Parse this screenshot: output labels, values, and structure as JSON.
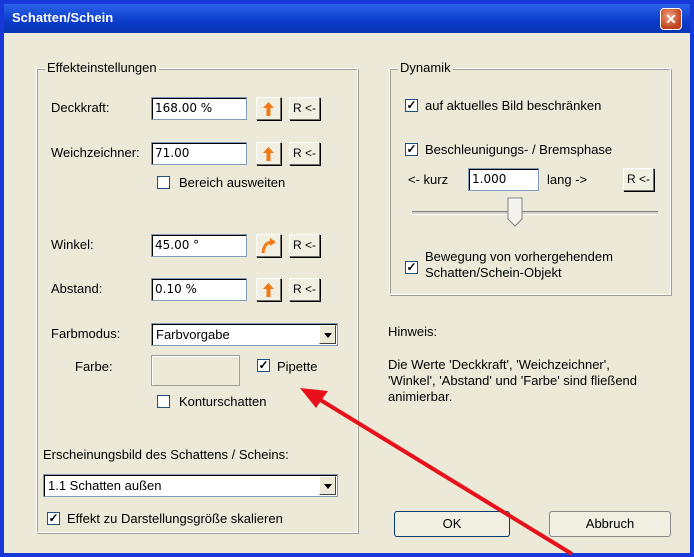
{
  "window": {
    "title": "Schatten/Schein",
    "close_symbol": "✕"
  },
  "effect_settings": {
    "group_label": "Effekteinstellungen",
    "opacity": {
      "label": "Deckkraft:",
      "value": "168.00 %",
      "reset_label": "R <-"
    },
    "blur": {
      "label": "Weichzeichner:",
      "value": "71.00",
      "reset_label": "R <-"
    },
    "expand_area": {
      "label": "Bereich ausweiten",
      "checked": false
    },
    "angle": {
      "label": "Winkel:",
      "value": "45.00 °",
      "reset_label": "R <-"
    },
    "distance": {
      "label": "Abstand:",
      "value": "0.10 %",
      "reset_label": "R <-"
    },
    "color_mode": {
      "label": "Farbmodus:",
      "value": "Farbvorgabe"
    },
    "color": {
      "label": "Farbe:"
    },
    "pipette": {
      "label": "Pipette",
      "checked": true,
      "check_symbol": "✓"
    },
    "contour_shadow": {
      "label": "Konturschatten",
      "checked": false
    },
    "appearance": {
      "label": "Erscheinungsbild des Schattens / Scheins:",
      "value": "1.1 Schatten außen"
    },
    "scale_effect": {
      "label": "Effekt zu Darstellungsgröße skalieren",
      "checked": true,
      "check_symbol": "✓"
    }
  },
  "dynamics": {
    "group_label": "Dynamik",
    "limit_current": {
      "label": "auf aktuelles Bild beschränken",
      "checked": true,
      "check_symbol": "✓"
    },
    "accel_phase": {
      "label": "Beschleunigungs- / Bremsphase",
      "checked": true,
      "check_symbol": "✓"
    },
    "short_label": "<- kurz",
    "phase_value": "1.000",
    "long_label": "lang ->",
    "reset_label": "R <-",
    "slider_fraction": 0.42,
    "motion": {
      "label_line1": "Bewegung von vorhergehendem",
      "label_line2": "Schatten/Schein-Objekt",
      "checked": true,
      "check_symbol": "✓"
    }
  },
  "hint": {
    "title": "Hinweis:",
    "line1": "Die Werte 'Deckkraft', 'Weichzeichner',",
    "line2": "'Winkel', 'Abstand' und 'Farbe' sind fließend",
    "line3": "animierbar."
  },
  "buttons": {
    "ok": "OK",
    "cancel": "Abbruch"
  },
  "colors": {
    "accent_orange": "#f07a14",
    "annotation_red": "#e8101a",
    "titlebar_blue": "#0a3bc9"
  }
}
